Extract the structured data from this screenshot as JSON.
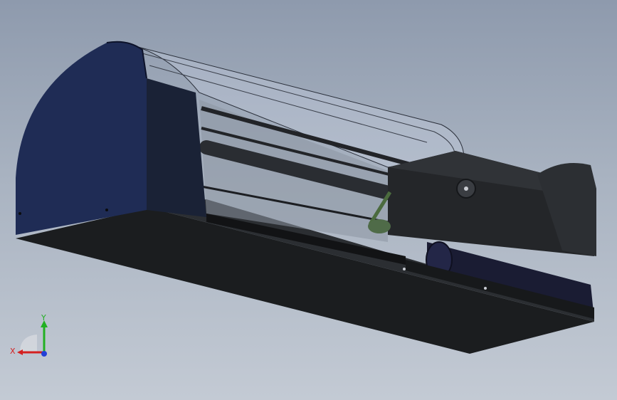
{
  "viewport": {
    "background_top": "#8e9aad",
    "background_bottom": "#c3cad4"
  },
  "model": {
    "end_cap_color": "#1f2c55",
    "base_color": "#1b1d1f",
    "cover_color": "#c8d2e2",
    "rod_color": "#2a2d32",
    "roller_color": "#1a1c33"
  },
  "triad": {
    "x_label": "X",
    "y_label": "Y",
    "x_color": "#d42020",
    "y_color": "#22b022",
    "z_color": "#2340d6"
  }
}
